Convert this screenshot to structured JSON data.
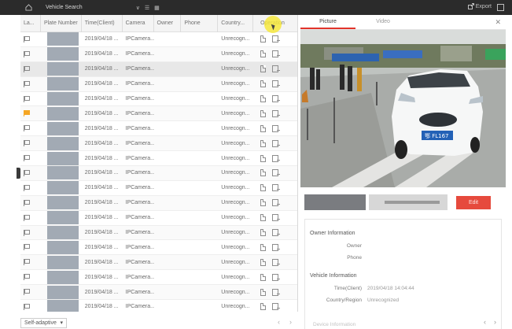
{
  "topbar": {
    "title": "Vehicle Search",
    "controls": [
      "∨",
      "☰",
      "▦"
    ],
    "export_label": "Export"
  },
  "table": {
    "headers": [
      "La...",
      "Plate Number",
      "Time(Client)",
      "Camera",
      "Owner",
      "Phone",
      "Country...",
      "Operation"
    ],
    "rows": [
      {
        "flag": false,
        "time": "2019/04/18 ...",
        "camera": "IPCamera...",
        "country": "Unrecogn...",
        "selected": false
      },
      {
        "flag": false,
        "time": "2019/04/18 ...",
        "camera": "IPCamera...",
        "country": "Unrecogn...",
        "selected": false
      },
      {
        "flag": false,
        "time": "2019/04/18 ...",
        "camera": "IPCamera...",
        "country": "Unrecogn...",
        "selected": true
      },
      {
        "flag": false,
        "time": "2019/04/18 ...",
        "camera": "IPCamera...",
        "country": "Unrecogn...",
        "selected": false
      },
      {
        "flag": false,
        "time": "2019/04/18 ...",
        "camera": "IPCamera...",
        "country": "Unrecogn...",
        "selected": false
      },
      {
        "flag": true,
        "time": "2019/04/18 ...",
        "camera": "IPCamera...",
        "country": "Unrecogn...",
        "selected": false
      },
      {
        "flag": false,
        "time": "2019/04/18 ...",
        "camera": "IPCamera...",
        "country": "Unrecogn...",
        "selected": false
      },
      {
        "flag": false,
        "time": "2019/04/18 ...",
        "camera": "IPCamera...",
        "country": "Unrecogn...",
        "selected": false
      },
      {
        "flag": false,
        "time": "2019/04/18 ...",
        "camera": "IPCamera...",
        "country": "Unrecogn...",
        "selected": false
      },
      {
        "flag": false,
        "time": "2019/04/18 ...",
        "camera": "IPCamera...",
        "country": "Unrecogn...",
        "selected": false
      },
      {
        "flag": false,
        "time": "2019/04/18 ...",
        "camera": "IPCamera...",
        "country": "Unrecogn...",
        "selected": false
      },
      {
        "flag": false,
        "time": "2019/04/18 ...",
        "camera": "IPCamera...",
        "country": "Unrecogn...",
        "selected": false
      },
      {
        "flag": false,
        "time": "2019/04/18 ...",
        "camera": "IPCamera...",
        "country": "Unrecogn...",
        "selected": false
      },
      {
        "flag": false,
        "time": "2019/04/18 ...",
        "camera": "IPCamera...",
        "country": "Unrecogn...",
        "selected": false
      },
      {
        "flag": false,
        "time": "2019/04/18 ...",
        "camera": "IPCamera...",
        "country": "Unrecogn...",
        "selected": false
      },
      {
        "flag": false,
        "time": "2019/04/18 ...",
        "camera": "IPCamera...",
        "country": "Unrecogn...",
        "selected": false
      },
      {
        "flag": false,
        "time": "2019/04/18 ...",
        "camera": "IPCamera...",
        "country": "Unrecogn...",
        "selected": false
      },
      {
        "flag": false,
        "time": "2019/04/18 ...",
        "camera": "IPCamera...",
        "country": "Unrecogn...",
        "selected": false
      },
      {
        "flag": false,
        "time": "2019/04/18 ...",
        "camera": "IPCamera...",
        "country": "Unrecogn...",
        "selected": false
      }
    ]
  },
  "bottom": {
    "display_mode": "Self-adaptive",
    "prev": "‹",
    "next": "›"
  },
  "panel": {
    "tabs": [
      "Picture",
      "Video"
    ],
    "active_tab": "Picture",
    "close": "✕",
    "plate_text": "鄂 FL167",
    "edit_label": "Edit",
    "owner_section": "Owner Information",
    "owner_fields": [
      {
        "label": "Owner",
        "value": ""
      },
      {
        "label": "Phone",
        "value": ""
      }
    ],
    "vehicle_section": "Vehicle Information",
    "vehicle_fields": [
      {
        "label": "Time(Client)",
        "value": "2019/04/18 14:04:44"
      },
      {
        "label": "Country/Region",
        "value": "Unrecognized"
      }
    ],
    "footer_text": "Device Information",
    "prev": "‹",
    "next": "›"
  },
  "colors": {
    "accent_red": "#e64a3d",
    "flag_orange": "#f5a623",
    "topbar": "#2b2b2b"
  }
}
